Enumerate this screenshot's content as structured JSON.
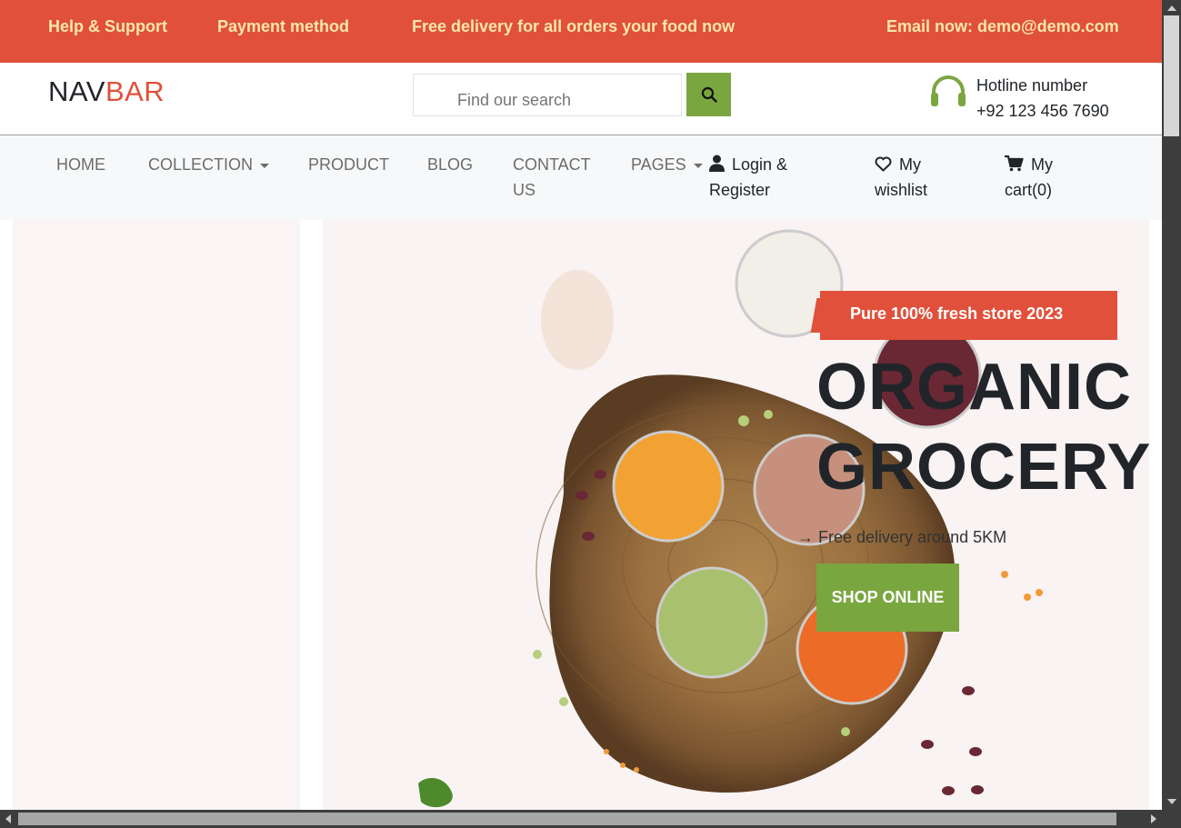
{
  "topbar": {
    "help": "Help & Support",
    "payment": "Payment method",
    "delivery": "Free delivery for all orders your food now",
    "email": "Email now: demo@demo.com"
  },
  "header": {
    "logo_main": "NAV",
    "logo_accent": "BAR",
    "search_placeholder": "Find our search",
    "hotline_label": "Hotline number",
    "hotline_number": "+92 123 456 7690",
    "icons": {
      "search": "search-icon",
      "hotline": "headset-icon"
    }
  },
  "nav": {
    "home": "HOME",
    "collection": "COLLECTION",
    "product": "PRODUCT",
    "blog": "BLOG",
    "contact_1": "CONTACT",
    "contact_2": "US",
    "pages": "PAGES",
    "login_1": "Login &",
    "login_2": "Register",
    "wishlist_1": "My",
    "wishlist_2": "wishlist",
    "cart_1": "My",
    "cart_2": "cart(0)"
  },
  "hero": {
    "badge": "Pure 100% fresh store 2023",
    "title_line1": "ORGANIC",
    "title_line2": "GROCERY",
    "subtitle": "Free delivery around 5KM",
    "cta": "SHOP ONLINE"
  },
  "colors": {
    "accent_red": "#e0503b",
    "accent_green": "#7aa640",
    "topbar_text": "#fde7a8"
  }
}
